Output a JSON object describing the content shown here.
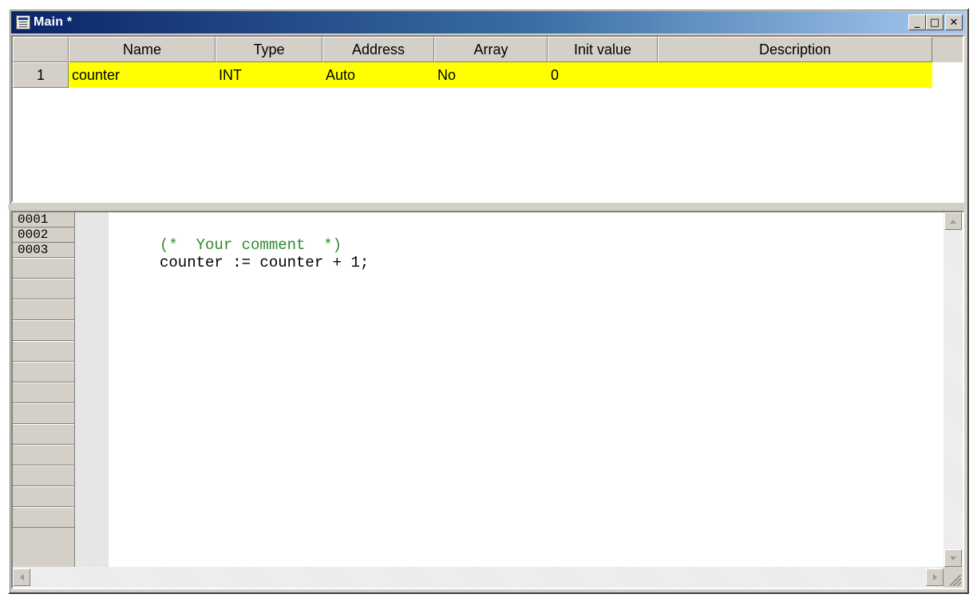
{
  "window": {
    "title": "Main *",
    "buttons": {
      "minimize": "_",
      "maximize": "□",
      "close": "✕"
    }
  },
  "declarations": {
    "columns": [
      "Name",
      "Type",
      "Address",
      "Array",
      "Init value",
      "Description"
    ],
    "rows": [
      {
        "num": "1",
        "name": "counter",
        "type": "INT",
        "address": "Auto",
        "array": "No",
        "init": "0",
        "description": ""
      }
    ],
    "highlight_color": "#ffff00"
  },
  "editor": {
    "line_numbers": [
      "0001",
      "0002",
      "0003"
    ],
    "lines": [
      {
        "text": "",
        "kind": "blank"
      },
      {
        "text": "(*  Your comment  *)",
        "kind": "comment"
      },
      {
        "text": "counter := counter + 1;",
        "kind": "code"
      }
    ],
    "comment_color": "#2e8b2e"
  },
  "icons": [
    "window-app-icon",
    "minimize-icon",
    "maximize-icon",
    "close-icon",
    "scroll-up-icon",
    "scroll-down-icon",
    "scroll-left-icon",
    "scroll-right-icon",
    "size-grip-icon"
  ]
}
